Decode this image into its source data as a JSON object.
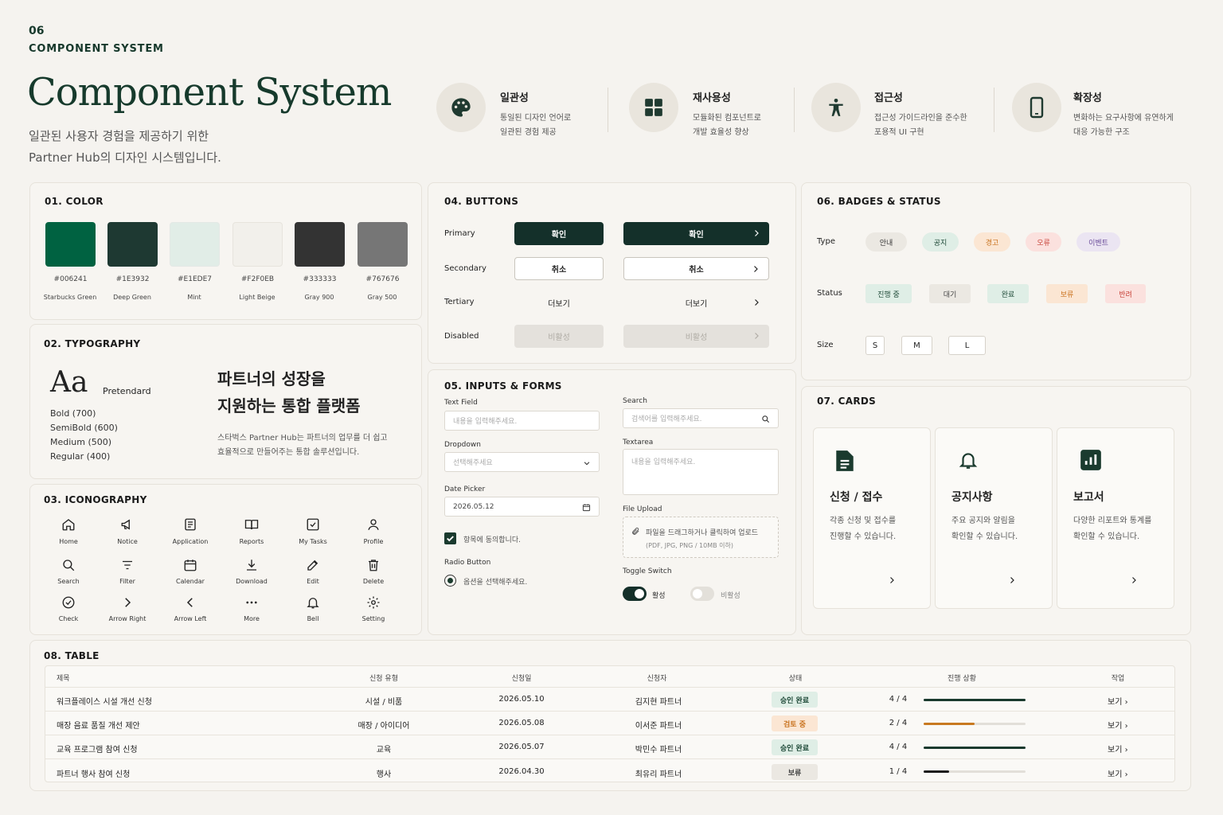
{
  "header": {
    "number": "06",
    "section": "COMPONENT SYSTEM",
    "title": "Component System",
    "desc1": "일관된 사용자 경험을 제공하기 위한",
    "desc2": "Partner Hub의 디자인 시스템입니다."
  },
  "principles": [
    {
      "title": "일관성",
      "l1": "통일된 디자인 언어로",
      "l2": "일관된 경험 제공",
      "icon": "palette-icon"
    },
    {
      "title": "재사용성",
      "l1": "모듈화된 컴포넌트로",
      "l2": "개발 효율성 향상",
      "icon": "modules-icon"
    },
    {
      "title": "접근성",
      "l1": "접근성 가이드라인을 준수한",
      "l2": "포용적 UI 구현",
      "icon": "accessibility-icon"
    },
    {
      "title": "확장성",
      "l1": "변화하는 요구사항에 유연하게",
      "l2": "대응 가능한 구조",
      "icon": "mobile-icon"
    }
  ],
  "color": {
    "title": "01. COLOR",
    "swatches": [
      {
        "hex": "#006241",
        "name": "Starbucks Green"
      },
      {
        "hex": "#1E3932",
        "name": "Deep Green"
      },
      {
        "hex": "#E1EDE7",
        "name": "Mint"
      },
      {
        "hex": "#F2F0EB",
        "name": "Light Beige"
      },
      {
        "hex": "#333333",
        "name": "Gray 900"
      },
      {
        "hex": "#767676",
        "name": "Gray 500"
      }
    ]
  },
  "typography": {
    "title": "02. TYPOGRAPHY",
    "sample": "Aa",
    "font": "Pretendard",
    "weights": [
      "Bold (700)",
      "SemiBold (600)",
      "Medium (500)",
      "Regular (400)"
    ],
    "headline1": "파트너의 성장을",
    "headline2": "지원하는 통합 플랫폼",
    "body1": "스타벅스 Partner Hub는 파트너의 업무를 더 쉽고",
    "body2": "효율적으로 만들어주는 통합 솔루션입니다."
  },
  "iconography": {
    "title": "03. ICONOGRAPHY",
    "items": [
      "Home",
      "Notice",
      "Application",
      "Reports",
      "My Tasks",
      "Profile",
      "Search",
      "Filter",
      "Calendar",
      "Download",
      "Edit",
      "Delete",
      "Check",
      "Arrow Right",
      "Arrow Left",
      "More",
      "Bell",
      "Setting"
    ]
  },
  "buttons": {
    "title": "04. BUTTONS",
    "primary": "Primary",
    "secondary": "Secondary",
    "tertiary": "Tertiary",
    "disabled": "Disabled",
    "confirm": "확인",
    "cancel": "취소",
    "more": "더보기",
    "inactive": "비활성"
  },
  "inputs": {
    "title": "05. INPUTS & FORMS",
    "text_label": "Text Field",
    "text_ph": "내용을 입력해주세요.",
    "dropdown_label": "Dropdown",
    "dropdown_ph": "선택해주세요",
    "date_label": "Date Picker",
    "date_value": "2026.05.12",
    "checkbox_label": "항목에 동의합니다.",
    "radio_title": "Radio Button",
    "radio_label": "옵션을 선택해주세요.",
    "search_label": "Search",
    "search_ph": "검색어를 입력해주세요.",
    "textarea_label": "Textarea",
    "textarea_ph": "내용을 입력해주세요.",
    "upload_label": "File Upload",
    "upload_text": "파일을 드래그하거나 클릭하여 업로드",
    "upload_hint": "(PDF, JPG, PNG / 10MB 이하)",
    "toggle_label": "Toggle Switch",
    "toggle_on": "활성",
    "toggle_off": "비활성"
  },
  "badges": {
    "title": "06. BADGES & STATUS",
    "type_label": "Type",
    "types": [
      "안내",
      "공지",
      "경고",
      "오류",
      "이벤트"
    ],
    "status_label": "Status",
    "statuses": [
      "진행 중",
      "대기",
      "완료",
      "보류",
      "반려"
    ],
    "size_label": "Size",
    "sizes": [
      "S",
      "M",
      "L"
    ]
  },
  "cards": {
    "title": "07. CARDS",
    "items": [
      {
        "title": "신청 / 접수",
        "l1": "각종 신청 및 접수를",
        "l2": "진행할 수 있습니다."
      },
      {
        "title": "공지사항",
        "l1": "주요 공지와 알림을",
        "l2": "확인할 수 있습니다."
      },
      {
        "title": "보고서",
        "l1": "다양한 리포트와 통계를",
        "l2": "확인할 수 있습니다."
      }
    ]
  },
  "table": {
    "title": "08. TABLE",
    "headers": [
      "제목",
      "신청 유형",
      "신청일",
      "신청자",
      "상태",
      "진행 상황",
      "작업"
    ],
    "rows": [
      {
        "title": "워크플레이스 시설 개선 신청",
        "type": "시설 / 비품",
        "date": "2026.05.10",
        "applicant": "김지현 파트너",
        "status": "승인 완료",
        "progress": "4 / 4",
        "pct": 1.0,
        "action": "보기"
      },
      {
        "title": "매장 음료 품질 개선 제안",
        "type": "매장 / 아이디어",
        "date": "2026.05.08",
        "applicant": "이서준 파트너",
        "status": "검토 중",
        "progress": "2 / 4",
        "pct": 0.5,
        "action": "보기"
      },
      {
        "title": "교육 프로그램 참여 신청",
        "type": "교육",
        "date": "2026.05.07",
        "applicant": "박민수 파트너",
        "status": "승인 완료",
        "progress": "4 / 4",
        "pct": 1.0,
        "action": "보기"
      },
      {
        "title": "파트너 행사 참여 신청",
        "type": "행사",
        "date": "2026.04.30",
        "applicant": "최유리 파트너",
        "status": "보류",
        "progress": "1 / 4",
        "pct": 0.25,
        "action": "보기"
      }
    ]
  }
}
